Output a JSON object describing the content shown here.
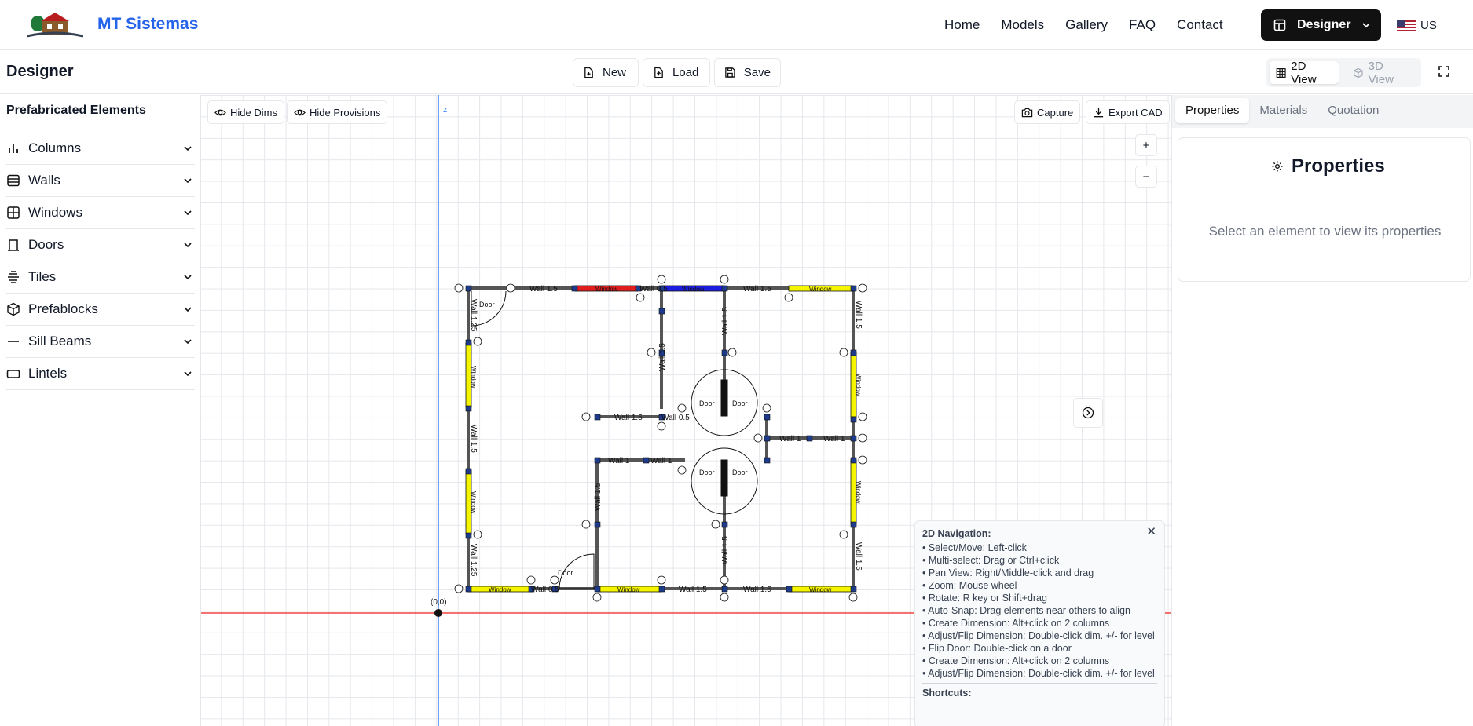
{
  "nav": {
    "brand": "MT Sistemas",
    "links": [
      "Home",
      "Models",
      "Gallery",
      "FAQ",
      "Contact"
    ],
    "designer_label": "Designer",
    "lang": "US"
  },
  "toolbar": {
    "title": "Designer",
    "new_label": "New",
    "load_label": "Load",
    "save_label": "Save",
    "view2d": "2D View",
    "view3d": "3D View"
  },
  "sidebar": {
    "title": "Prefabricated Elements",
    "items": [
      {
        "label": "Columns",
        "icon": "bar-chart-icon"
      },
      {
        "label": "Walls",
        "icon": "layers-icon"
      },
      {
        "label": "Windows",
        "icon": "grid-icon"
      },
      {
        "label": "Doors",
        "icon": "door-icon"
      },
      {
        "label": "Tiles",
        "icon": "tiles-icon"
      },
      {
        "label": "Prefablocks",
        "icon": "box-icon"
      },
      {
        "label": "Sill Beams",
        "icon": "minus-icon"
      },
      {
        "label": "Lintels",
        "icon": "rectangle-icon"
      }
    ]
  },
  "canvas": {
    "hide_dims": "Hide Dims",
    "hide_provisions": "Hide Provisions",
    "capture": "Capture",
    "export_cad": "Export CAD",
    "zoom_in": "+",
    "zoom_out": "−",
    "axis_z": "z",
    "origin": "(0,0)",
    "labels": {
      "wall_15": "Wall 1.5",
      "wall_1": "Wall 1",
      "wall_125": "Wall 1.25",
      "wall_05": "Wall 0.5",
      "window": "Window",
      "door": "Door"
    }
  },
  "help": {
    "title": "2D Navigation:",
    "lines": [
      "• Select/Move: Left-click",
      "• Multi-select: Drag or Ctrl+click",
      "• Pan View: Right/Middle-click and drag",
      "• Zoom: Mouse wheel",
      "• Rotate: R key or Shift+drag",
      "• Auto-Snap: Drag elements near others to align",
      "• Create Dimension: Alt+click on 2 columns",
      "• Adjust/Flip Dimension: Double-click dim. +/- for level",
      "• Flip Door: Double-click on a door",
      "• Create Dimension: Alt+click on 2 columns",
      "• Adjust/Flip Dimension: Double-click dim. +/- for level"
    ],
    "shortcuts": "Shortcuts:",
    "close": "✕"
  },
  "panel": {
    "tabs": [
      "Properties",
      "Materials",
      "Quotation"
    ],
    "heading": "Properties",
    "empty": "Select an element to view its properties"
  },
  "colors": {
    "brand": "#2563eb",
    "x_axis": "#ef4444",
    "z_axis": "#3b82f6",
    "window_yellow": "#f5f500",
    "window_red": "#e11d1d",
    "window_blue": "#1d1de1"
  }
}
